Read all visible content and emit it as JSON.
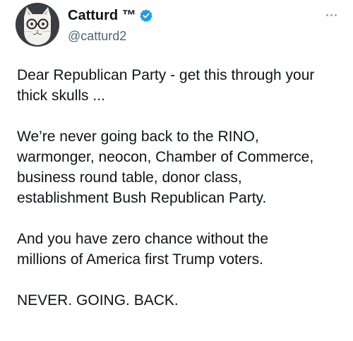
{
  "author": {
    "display_name": "Catturd ™",
    "handle": "@catturd2",
    "verified": true,
    "verified_color": "#1d9bf0",
    "avatar_icon": "cat-with-glasses-avatar"
  },
  "menu": {
    "icon": "more-horizontal-icon"
  },
  "tweet": {
    "paragraphs": [
      "Dear Republican Party - get this through your\nthick skulls ...",
      "We’re never going back to the RINO,\nwarmonger, neocon, Chamber of Commerce,\nbusiness round table, donor class,\nestablishment Bush Republican Party.",
      "And you have zero chance without the\nmillions of America first Trump voters.",
      "NEVER. GOING. BACK."
    ]
  }
}
